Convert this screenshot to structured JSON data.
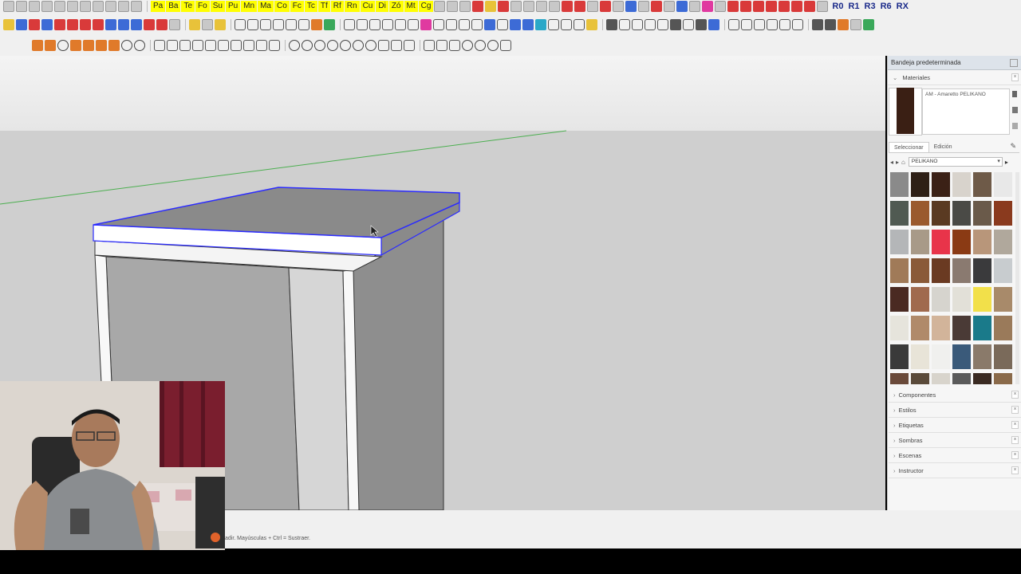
{
  "toolbar": {
    "yellow_tabs": [
      "Pa",
      "Ba",
      "Te",
      "Fo",
      "Su",
      "Pu",
      "Mn",
      "Ma",
      "Co",
      "Fc",
      "Tc",
      "Tf",
      "Rf",
      "Rn",
      "Cu",
      "Di",
      "Zó",
      "Mt",
      "Cg"
    ],
    "r_tabs": [
      "R0",
      "R1",
      "R3",
      "R6",
      "RX"
    ]
  },
  "tray": {
    "title": "Bandeja predeterminada",
    "materials": {
      "header": "Materiales",
      "current_material": "AM - Amaretto PELIKANO",
      "current_color": "#3a1f14",
      "tab_select": "Seleccionar",
      "tab_edit": "Edición",
      "library": "PELIKANO",
      "swatches": [
        "#8a8a8a",
        "#2e2016",
        "#3b2116",
        "#d8d3cc",
        "#6e5a48",
        "#e8e8e8",
        "#505a52",
        "#9a5a2e",
        "#5a3a22",
        "#4a4a46",
        "#6a5a4a",
        "#8a3a1e",
        "#b4b6b8",
        "#a89a88",
        "#e8344a",
        "#8a3a14",
        "#b8967a",
        "#b0a89c",
        "#a07a58",
        "#8a5a38",
        "#6a3a22",
        "#8a7a70",
        "#3a3a3c",
        "#c8cccf",
        "#4a2a22",
        "#a06a4e",
        "#d6d4ce",
        "#e2e0d8",
        "#f2e04a",
        "#a88a6a",
        "#e6e4dc",
        "#b08a6a",
        "#d2b49a",
        "#4a3a36",
        "#1a7a8a",
        "#9a7a5a",
        "#3a3a3a",
        "#e8e4d8",
        "#f0f0ee",
        "#3a5a7a",
        "#8a7a6a",
        "#7a6a5a",
        "#6a4a3a",
        "#5a4a3a",
        "#d8d4cc",
        "#5a5a5a",
        "#3a2a22",
        "#8a6a4a"
      ]
    },
    "panels": [
      "Componentes",
      "Estilos",
      "Etiquetas",
      "Sombras",
      "Escenas",
      "Instructor"
    ]
  },
  "status": {
    "text": "adir. Mayúsculas + Ctrl = Sustraer."
  }
}
